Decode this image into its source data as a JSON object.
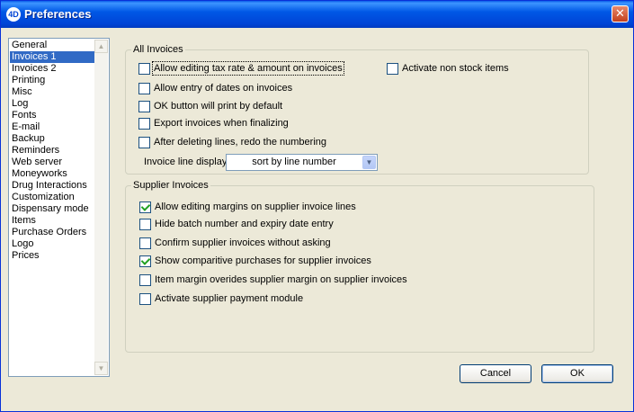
{
  "window": {
    "title": "Preferences",
    "app_icon": "4D"
  },
  "sidebar": {
    "items": [
      {
        "label": "General",
        "selected": false
      },
      {
        "label": "Invoices 1",
        "selected": true
      },
      {
        "label": "Invoices 2",
        "selected": false
      },
      {
        "label": "Printing",
        "selected": false
      },
      {
        "label": "Misc",
        "selected": false
      },
      {
        "label": "Log",
        "selected": false
      },
      {
        "label": "Fonts",
        "selected": false
      },
      {
        "label": "E-mail",
        "selected": false
      },
      {
        "label": "Backup",
        "selected": false
      },
      {
        "label": "Reminders",
        "selected": false
      },
      {
        "label": "Web server",
        "selected": false
      },
      {
        "label": "Moneyworks",
        "selected": false
      },
      {
        "label": "Drug Interactions",
        "selected": false
      },
      {
        "label": "Customization",
        "selected": false
      },
      {
        "label": "Dispensary mode",
        "selected": false
      },
      {
        "label": "Items",
        "selected": false
      },
      {
        "label": "Purchase Orders",
        "selected": false
      },
      {
        "label": "Logo",
        "selected": false
      },
      {
        "label": "Prices",
        "selected": false
      }
    ]
  },
  "all_invoices": {
    "title": "All Invoices",
    "options": [
      {
        "label": "Allow editing tax rate & amount on invoices",
        "checked": false
      },
      {
        "label": "Allow entry of dates on invoices",
        "checked": false
      },
      {
        "label": "OK button will print by default",
        "checked": false
      },
      {
        "label": "Export invoices when finalizing",
        "checked": false
      },
      {
        "label": "After deleting lines, redo the numbering",
        "checked": false
      },
      {
        "label": "Activate non stock items",
        "checked": false
      }
    ],
    "line_display_label": "Invoice line display",
    "line_display_value": "sort by line number"
  },
  "supplier_invoices": {
    "title": "Supplier Invoices",
    "options": [
      {
        "label": "Allow editing margins on supplier invoice lines",
        "checked": true
      },
      {
        "label": "Hide batch number and expiry date entry",
        "checked": false
      },
      {
        "label": "Confirm supplier invoices without asking",
        "checked": false
      },
      {
        "label": "Show comparitive purchases for supplier invoices",
        "checked": true
      },
      {
        "label": "Item margin overides supplier margin on supplier invoices",
        "checked": false
      },
      {
        "label": "Activate supplier payment module",
        "checked": false
      }
    ]
  },
  "buttons": {
    "cancel": "Cancel",
    "ok": "OK"
  }
}
